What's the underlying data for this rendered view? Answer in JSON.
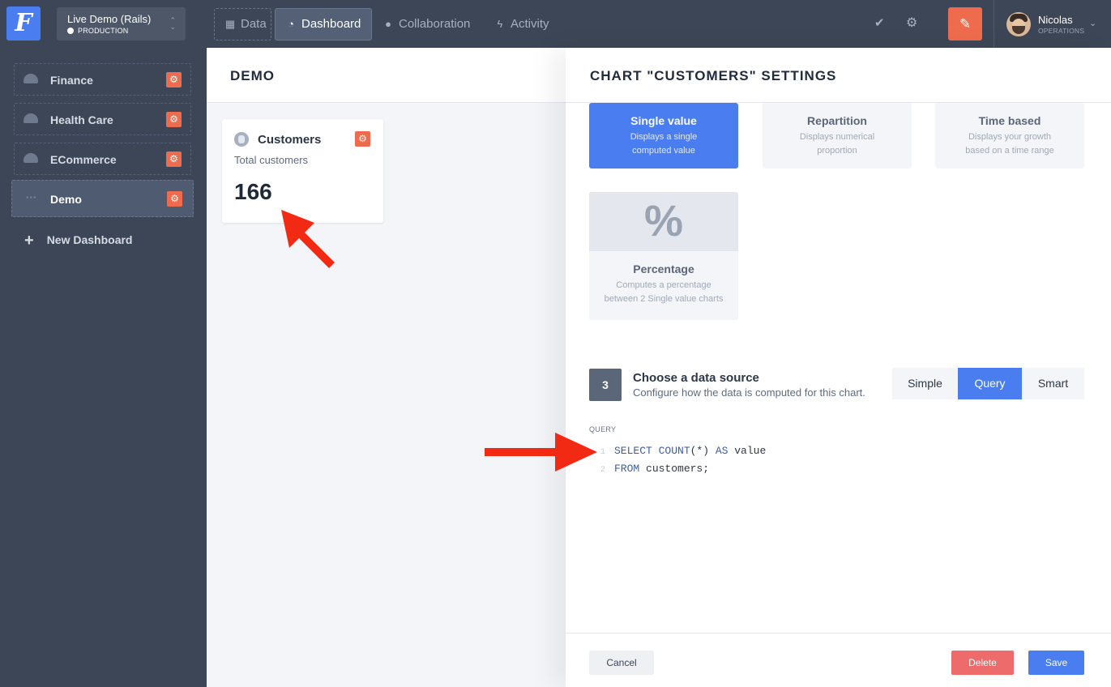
{
  "app": {
    "logo_letter": "F",
    "project_name": "Live Demo (Rails)",
    "project_env": "PRODUCTION"
  },
  "nav": {
    "tabs": [
      {
        "label": "Data",
        "icon": "table-icon"
      },
      {
        "label": "Dashboard",
        "icon": "dashboard-icon"
      },
      {
        "label": "Collaboration",
        "icon": "chat-icon"
      },
      {
        "label": "Activity",
        "icon": "bolt-icon"
      }
    ],
    "active_tab": "Dashboard"
  },
  "user": {
    "name": "Nicolas",
    "role": "OPERATIONS"
  },
  "sidebar": {
    "items": [
      {
        "label": "Finance"
      },
      {
        "label": "Health Care"
      },
      {
        "label": "ECommerce"
      },
      {
        "label": "Demo"
      }
    ],
    "active_item": "Demo",
    "new_label": "New Dashboard"
  },
  "dashboard": {
    "title": "DEMO",
    "card": {
      "title": "Customers",
      "subtitle": "Total customers",
      "value": "166"
    }
  },
  "settings": {
    "title": "CHART \"CUSTOMERS\" SETTINGS",
    "chart_types": [
      {
        "name": "Single value",
        "desc1": "Displays a single",
        "desc2": "computed value"
      },
      {
        "name": "Repartition",
        "desc1": "Displays numerical",
        "desc2": "proportion"
      },
      {
        "name": "Time based",
        "desc1": "Displays your growth",
        "desc2": "based on a time range"
      },
      {
        "name": "Percentage",
        "desc1": "Computes a percentage",
        "desc2": "between 2 Single value charts",
        "glyph": "%"
      }
    ],
    "selected_type": "Single value",
    "step": {
      "number": "3",
      "title": "Choose a data source",
      "desc": "Configure how the data is computed for this chart."
    },
    "source_modes": [
      "Simple",
      "Query",
      "Smart"
    ],
    "selected_mode": "Query",
    "query_label": "QUERY",
    "query_lines": [
      {
        "n": "1",
        "kw1": "SELECT COUNT",
        "mid": "(*) ",
        "kw2": "AS",
        "rest": " value"
      },
      {
        "n": "2",
        "kw1": "FROM",
        "mid": " customers;",
        "kw2": "",
        "rest": ""
      }
    ],
    "buttons": {
      "cancel": "Cancel",
      "delete": "Delete",
      "save": "Save"
    }
  },
  "colors": {
    "topbar": "#3d4656",
    "accent": "#4a7ef0",
    "orange": "#ee6c4d",
    "danger": "#ee6b6b",
    "annotation_arrow": "#f22a14"
  }
}
